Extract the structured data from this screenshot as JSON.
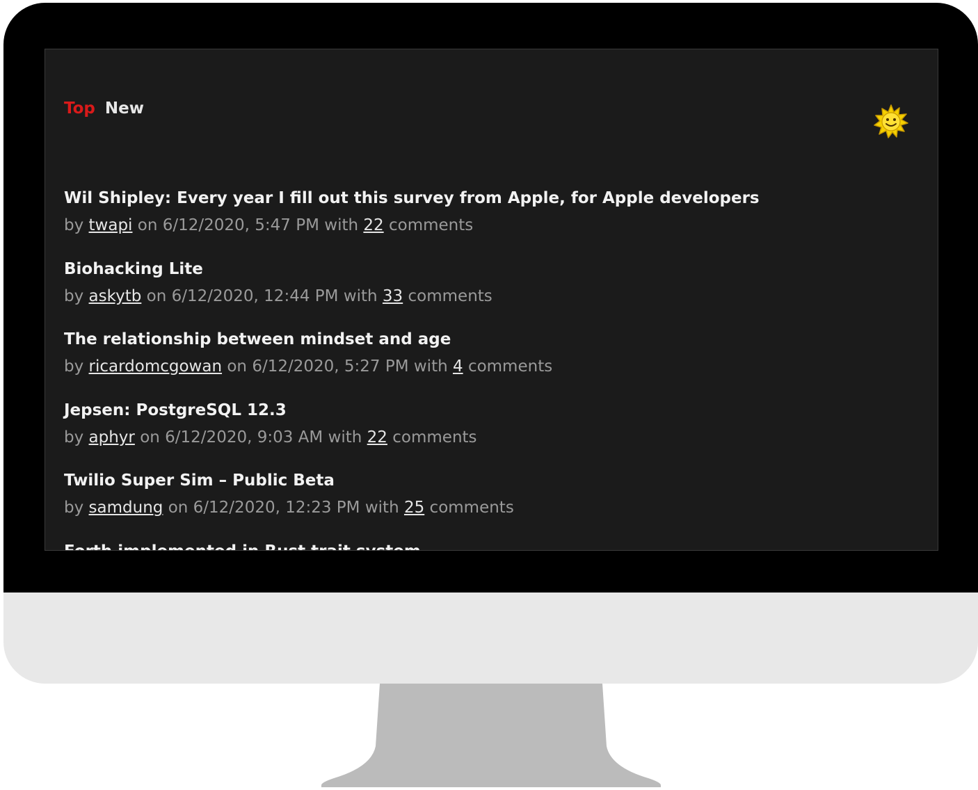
{
  "nav": {
    "items": [
      {
        "label": "Top",
        "active": true
      },
      {
        "label": "New",
        "active": false
      }
    ]
  },
  "theme_toggle": {
    "icon": "sun-icon",
    "color": "#f5d000"
  },
  "colors": {
    "accent": "#d91a1a",
    "background": "#1b1b1b",
    "meta_text": "#9a9a9a",
    "title_text": "#f2f2f2"
  },
  "meta_labels": {
    "by": "by",
    "on": "on",
    "with": "with",
    "comments": "comments"
  },
  "stories": [
    {
      "title": "Wil Shipley: Every year I fill out this survey from Apple, for Apple developers",
      "author": "twapi",
      "date": "6/12/2020, 5:47 PM",
      "comments": "22"
    },
    {
      "title": "Biohacking Lite",
      "author": "askytb",
      "date": "6/12/2020, 12:44 PM",
      "comments": "33"
    },
    {
      "title": "The relationship between mindset and age",
      "author": "ricardomcgowan",
      "date": "6/12/2020, 5:27 PM",
      "comments": "4"
    },
    {
      "title": "Jepsen: PostgreSQL 12.3",
      "author": "aphyr",
      "date": "6/12/2020, 9:03 AM",
      "comments": "22"
    },
    {
      "title": "Twilio Super Sim – Public Beta",
      "author": "samdung",
      "date": "6/12/2020, 12:23 PM",
      "comments": "25"
    },
    {
      "title": "Forth implemented in Rust trait system",
      "author": "",
      "date": "",
      "comments": ""
    }
  ]
}
